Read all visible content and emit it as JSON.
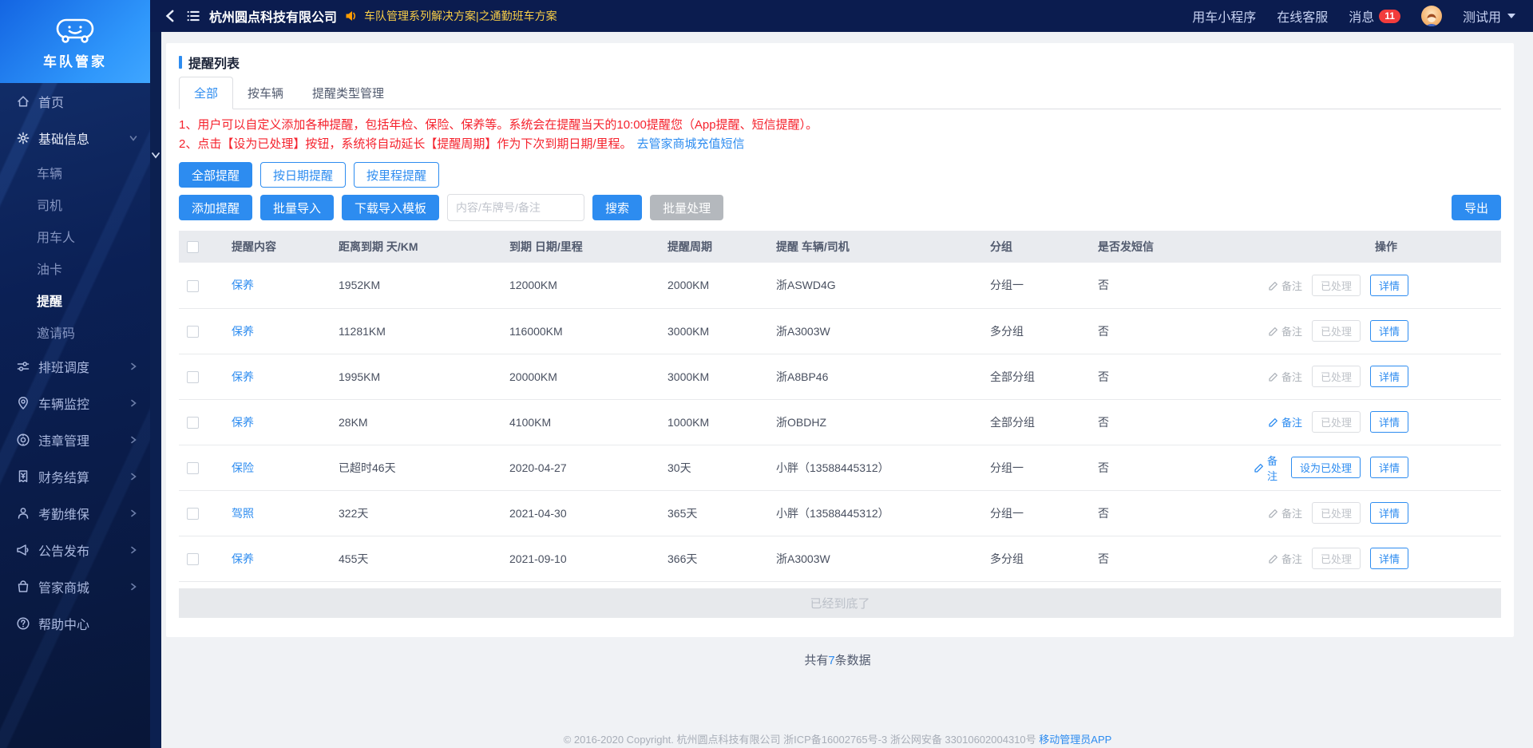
{
  "brand": {
    "name": "车队管家"
  },
  "topbar": {
    "company": "杭州圆点科技有限公司",
    "announcement": "车队管理系列解决方案|之通勤班车方案",
    "mini_program": "用车小程序",
    "online_service": "在线客服",
    "messages_label": "消息",
    "message_count": "11",
    "username": "测试用"
  },
  "sidebar": {
    "items": [
      {
        "id": "home",
        "label": "首页",
        "icon": "home",
        "type": "top"
      },
      {
        "id": "basic-info",
        "label": "基础信息",
        "icon": "gear",
        "type": "top",
        "expanded": true
      },
      {
        "id": "vehicles",
        "label": "车辆",
        "type": "sub"
      },
      {
        "id": "drivers",
        "label": "司机",
        "type": "sub"
      },
      {
        "id": "car-users",
        "label": "用车人",
        "type": "sub"
      },
      {
        "id": "fuel-cards",
        "label": "油卡",
        "type": "sub"
      },
      {
        "id": "reminders",
        "label": "提醒",
        "type": "sub",
        "active": true
      },
      {
        "id": "invite-codes",
        "label": "邀请码",
        "type": "sub"
      },
      {
        "id": "scheduling",
        "label": "排班调度",
        "icon": "sliders",
        "type": "top",
        "chevron": true
      },
      {
        "id": "vehicle-monitoring",
        "label": "车辆监控",
        "icon": "location",
        "type": "top",
        "chevron": true
      },
      {
        "id": "violation-management",
        "label": "违章管理",
        "icon": "camera",
        "type": "top",
        "chevron": true
      },
      {
        "id": "finance-settlement",
        "label": "财务结算",
        "icon": "receipt",
        "type": "top",
        "chevron": true
      },
      {
        "id": "attendance-maintenance",
        "label": "考勤维保",
        "icon": "person",
        "type": "top",
        "chevron": true
      },
      {
        "id": "announcements",
        "label": "公告发布",
        "icon": "megaphone",
        "type": "top",
        "chevron": true
      },
      {
        "id": "butler-mall",
        "label": "管家商城",
        "icon": "mall",
        "type": "top",
        "chevron": true
      },
      {
        "id": "help-center",
        "label": "帮助中心",
        "icon": "help",
        "type": "top"
      }
    ]
  },
  "page": {
    "title": "提醒列表",
    "tabs": [
      {
        "label": "全部",
        "active": true
      },
      {
        "label": "按车辆",
        "active": false
      },
      {
        "label": "提醒类型管理",
        "active": false
      }
    ],
    "notices": {
      "line1": "1、用户可以自定义添加各种提醒，包括年检、保险、保养等。系统会在提醒当天的10:00提醒您（App提醒、短信提醒）。",
      "line2": "2、点击【设为已处理】按钮，系统将自动延长【提醒周期】作为下次到期日期/里程。",
      "link": "去管家商城充值短信"
    },
    "filters": [
      {
        "label": "全部提醒",
        "active": true
      },
      {
        "label": "按日期提醒",
        "active": false
      },
      {
        "label": "按里程提醒",
        "active": false
      }
    ],
    "toolbar": {
      "add": "添加提醒",
      "batch_import": "批量导入",
      "download_template": "下载导入模板",
      "search_placeholder": "内容/车牌号/备注",
      "search": "搜索",
      "batch_process": "批量处理",
      "export": "导出"
    },
    "table": {
      "columns": {
        "content": "提醒内容",
        "remaining": "距离到期 天/KM",
        "due": "到期 日期/里程",
        "cycle": "提醒周期",
        "target": "提醒 车辆/司机",
        "group": "分组",
        "sms": "是否发短信",
        "actions": "操作"
      },
      "rows": [
        {
          "content": "保养",
          "remaining": "1952KM",
          "due": "12000KM",
          "cycle": "2000KM",
          "target": "浙ASWD4G",
          "group": "分组一",
          "sms": "否",
          "note": "备注",
          "note_style": "gray",
          "process": "已处理",
          "process_style": "disabled",
          "detail": "详情"
        },
        {
          "content": "保养",
          "remaining": "11281KM",
          "due": "116000KM",
          "cycle": "3000KM",
          "target": "浙A3003W",
          "group": "多分组",
          "sms": "否",
          "note": "备注",
          "note_style": "gray",
          "process": "已处理",
          "process_style": "disabled",
          "detail": "详情"
        },
        {
          "content": "保养",
          "remaining": "1995KM",
          "due": "20000KM",
          "cycle": "3000KM",
          "target": "浙A8BP46",
          "group": "全部分组",
          "sms": "否",
          "note": "备注",
          "note_style": "gray",
          "process": "已处理",
          "process_style": "disabled",
          "detail": "详情"
        },
        {
          "content": "保养",
          "remaining": "28KM",
          "due": "4100KM",
          "cycle": "1000KM",
          "target": "浙OBDHZ",
          "group": "全部分组",
          "sms": "否",
          "note": "备注",
          "note_style": "blue",
          "process": "已处理",
          "process_style": "disabled",
          "detail": "详情"
        },
        {
          "content": "保险",
          "remaining": "已超时46天",
          "due": "2020-04-27",
          "cycle": "30天",
          "target": "小胖（13588445312）",
          "group": "分组一",
          "sms": "否",
          "note": "备注",
          "note_style": "blue",
          "process": "设为已处理",
          "process_style": "primary",
          "detail": "详情"
        },
        {
          "content": "驾照",
          "remaining": "322天",
          "due": "2021-04-30",
          "cycle": "365天",
          "target": "小胖（13588445312）",
          "group": "分组一",
          "sms": "否",
          "note": "备注",
          "note_style": "gray",
          "process": "已处理",
          "process_style": "disabled",
          "detail": "详情"
        },
        {
          "content": "保养",
          "remaining": "455天",
          "due": "2021-09-10",
          "cycle": "366天",
          "target": "浙A3003W",
          "group": "多分组",
          "sms": "否",
          "note": "备注",
          "note_style": "gray",
          "process": "已处理",
          "process_style": "disabled",
          "detail": "详情"
        }
      ],
      "end_text": "已经到底了"
    },
    "summary": {
      "prefix": "共有",
      "count": "7",
      "suffix": "条数据"
    },
    "footer": {
      "text": "© 2016-2020 Copyright. 杭州圆点科技有限公司 浙ICP备16002765号-3 浙公网安备 33010602004310号",
      "link": "移动管理员APP"
    }
  },
  "colors": {
    "primary": "#2d8cf0",
    "danger": "#f5222d",
    "announcement_yellow": "#f8ce47",
    "badge_red": "#f23c3c",
    "sidebar_navy": "#0b1c4f"
  }
}
